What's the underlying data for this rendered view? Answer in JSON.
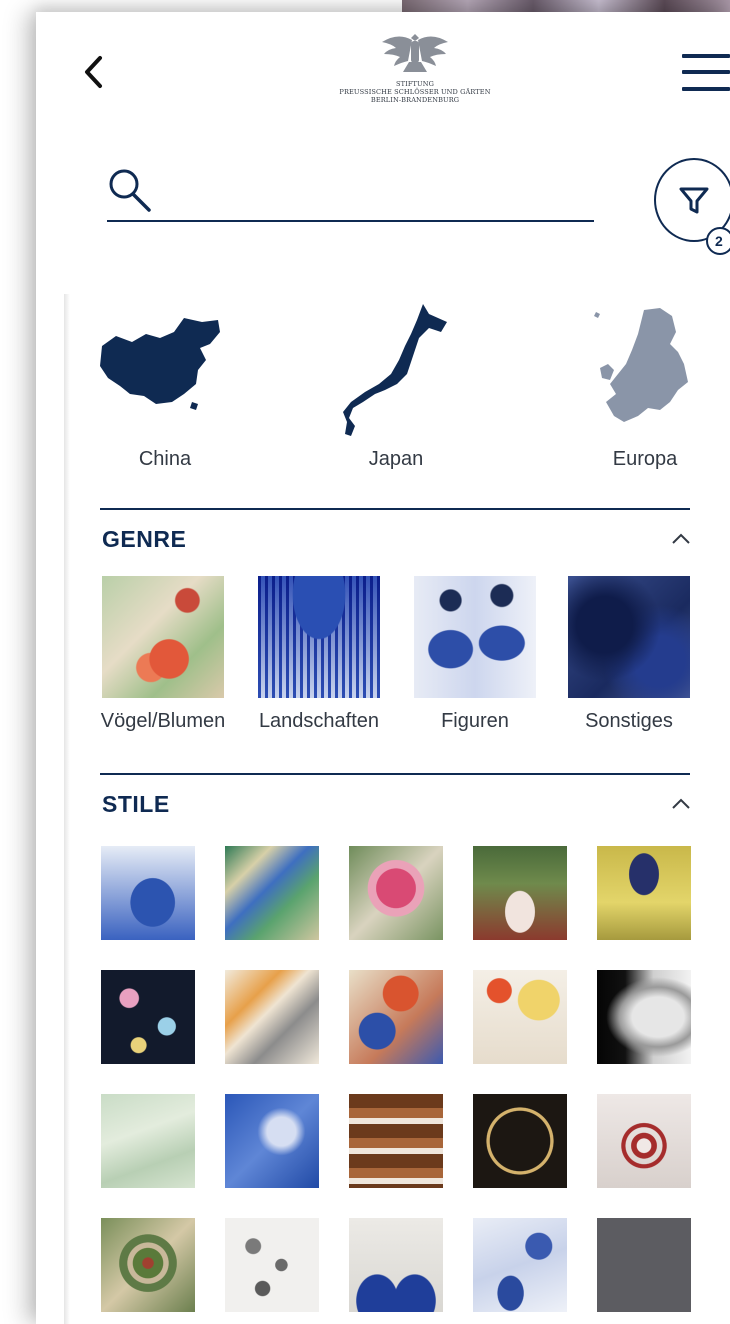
{
  "header": {
    "back_icon": "chevron-left-icon",
    "logo_icon": "prussian-eagle-icon",
    "logo_text": "STIFTUNG\nPREUSSISCHE SCHLÖSSER UND GÄRTEN\nBERLIN-BRANDENBURG",
    "menu_icon": "hamburger-menu-icon"
  },
  "search": {
    "icon": "search-icon",
    "value": "",
    "placeholder": ""
  },
  "filter": {
    "icon": "funnel-filter-icon",
    "badge_count": "2"
  },
  "regions": [
    {
      "label": "China",
      "icon": "china-map-icon",
      "color": "#0f2a52"
    },
    {
      "label": "Japan",
      "icon": "japan-map-icon",
      "color": "#0f2a52"
    },
    {
      "label": "Europa",
      "icon": "europe-map-icon",
      "color": "#8a95a8"
    }
  ],
  "genre": {
    "title": "GENRE",
    "collapse_icon": "chevron-up-icon",
    "items": [
      {
        "label": "Vögel/Blumen",
        "image": "birds-flowers-porcelain-thumb"
      },
      {
        "label": "Landschaften",
        "image": "landscape-blue-white-thumb"
      },
      {
        "label": "Figuren",
        "image": "figures-blue-white-thumb"
      },
      {
        "label": "Sonstiges",
        "image": "blurred-blue-thumb"
      }
    ]
  },
  "stile": {
    "title": "STILE",
    "collapse_icon": "chevron-up-icon",
    "thumbnails": [
      "blue-horse-thumb",
      "famille-verte-landscape-thumb",
      "pink-peony-thumb",
      "green-red-panel-thumb",
      "yellow-vase-thumb",
      "black-floral-thumb",
      "iris-flower-thumb",
      "imari-flower-thumb",
      "parasol-lady-thumb",
      "white-figure-thumb",
      "celadon-thumb",
      "blue-crackle-thumb",
      "brown-glaze-thumb",
      "black-gold-thumb",
      "red-dragon-thumb",
      "green-medallion-thumb",
      "white-lattice-thumb",
      "blue-wave-thumb",
      "blue-landscape-thumb",
      "grey-placeholder-thumb"
    ]
  },
  "colors": {
    "primary": "#0f2a52",
    "text": "#333a44",
    "placeholder_tile": "#5c5c61"
  }
}
